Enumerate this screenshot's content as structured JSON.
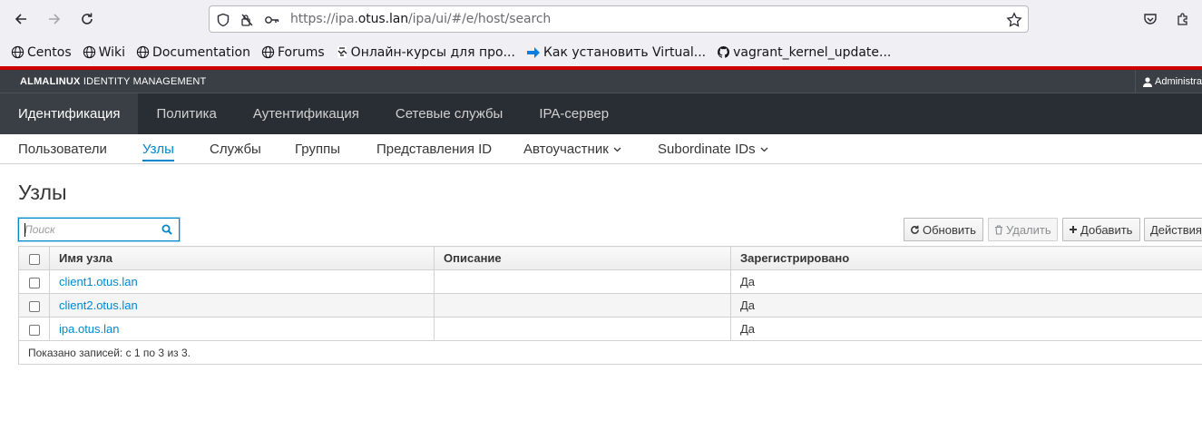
{
  "browser": {
    "url_prefix": "https://ipa.",
    "url_host": "otus.lan",
    "url_path": "/ipa/ui/#/e/host/search",
    "bookmarks": [
      {
        "label": "Centos",
        "icon": "globe-icon"
      },
      {
        "label": "Wiki",
        "icon": "globe-icon"
      },
      {
        "label": "Documentation",
        "icon": "globe-icon"
      },
      {
        "label": "Forums",
        "icon": "globe-icon"
      },
      {
        "label": "Онлайн-курсы для про...",
        "icon": "otus-icon"
      },
      {
        "label": "Как установить Virtual...",
        "icon": "arrow-right-icon"
      },
      {
        "label": "vagrant_kernel_update...",
        "icon": "github-icon"
      }
    ]
  },
  "header": {
    "brand_bold": "ALMALINUX",
    "brand_rest": " IDENTITY MANAGEMENT",
    "user": "Administra"
  },
  "topnav": [
    {
      "label": "Идентификация",
      "active": true
    },
    {
      "label": "Политика"
    },
    {
      "label": "Аутентификация"
    },
    {
      "label": "Сетевые службы"
    },
    {
      "label": "IPA-сервер"
    }
  ],
  "subnav": [
    {
      "label": "Пользователи"
    },
    {
      "label": "Узлы",
      "active": true
    },
    {
      "label": "Службы"
    },
    {
      "label": "Группы"
    },
    {
      "label": "Представления ID"
    },
    {
      "label": "Автоучастник",
      "dropdown": true
    },
    {
      "label": "Subordinate IDs",
      "dropdown": true
    }
  ],
  "main": {
    "title": "Узлы",
    "search_placeholder": "Поиск",
    "buttons": {
      "refresh": "Обновить",
      "delete": "Удалить",
      "add": "Добавить",
      "actions": "Действия"
    },
    "columns": [
      "Имя узла",
      "Описание",
      "Зарегистрировано"
    ],
    "rows": [
      {
        "host": "client1.otus.lan",
        "description": "",
        "enrolled": "Да"
      },
      {
        "host": "client2.otus.lan",
        "description": "",
        "enrolled": "Да"
      },
      {
        "host": "ipa.otus.lan",
        "description": "",
        "enrolled": "Да"
      }
    ],
    "footer": "Показано записей: с 1 по 3 из 3."
  },
  "colors": {
    "accent": "#0088ce",
    "chrome_red": "#cc0000",
    "masthead": "#393f44",
    "nav": "#292e34"
  }
}
